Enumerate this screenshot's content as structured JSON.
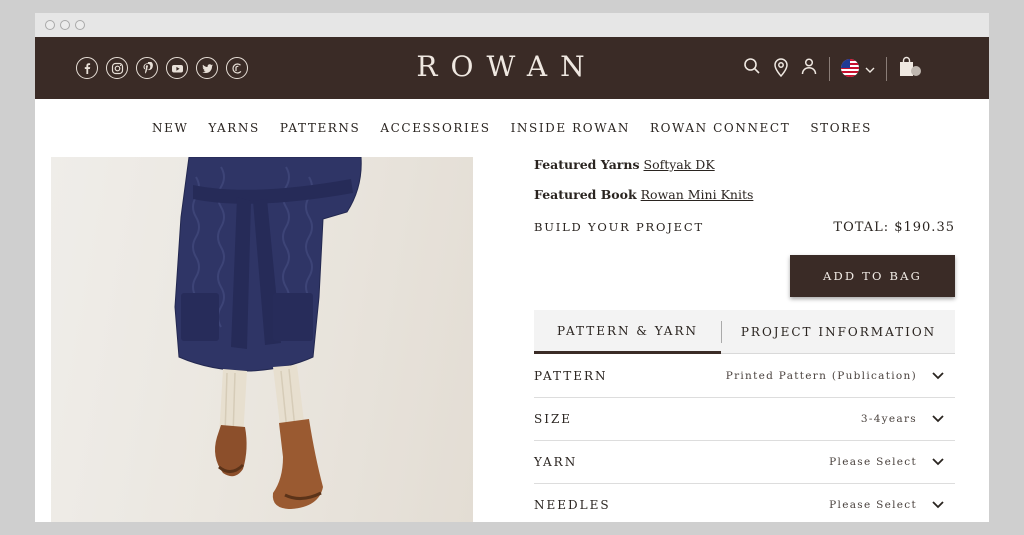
{
  "brand": {
    "logo_text": "ROWAN"
  },
  "header": {
    "social_icons": [
      "facebook-icon",
      "instagram-icon",
      "pinterest-icon",
      "youtube-icon",
      "twitter-icon",
      "ravelry-icon"
    ],
    "colors": {
      "header_bg": "#3a2b26",
      "header_text": "#efe8e1"
    }
  },
  "nav": {
    "items": [
      "NEW",
      "YARNS",
      "PATTERNS",
      "ACCESSORIES",
      "INSIDE ROWAN",
      "ROWAN CONNECT",
      "STORES"
    ]
  },
  "product": {
    "featured_yarns_label": "Featured Yarns",
    "featured_yarns_value": "Softyak DK",
    "featured_book_label": "Featured Book",
    "featured_book_value": "Rowan Mini Knits",
    "build_label": "BUILD YOUR PROJECT",
    "total": "TOTAL: $190.35",
    "add_to_bag": "ADD TO BAG"
  },
  "tabs": [
    {
      "label": "PATTERN & YARN",
      "active": true
    },
    {
      "label": "PROJECT INFORMATION",
      "active": false
    }
  ],
  "options": [
    {
      "label": "PATTERN",
      "value": "Printed Pattern (Publication)"
    },
    {
      "label": "SIZE",
      "value": "3-4years"
    },
    {
      "label": "YARN",
      "value": "Please Select"
    },
    {
      "label": "NEEDLES",
      "value": "Please Select"
    }
  ]
}
